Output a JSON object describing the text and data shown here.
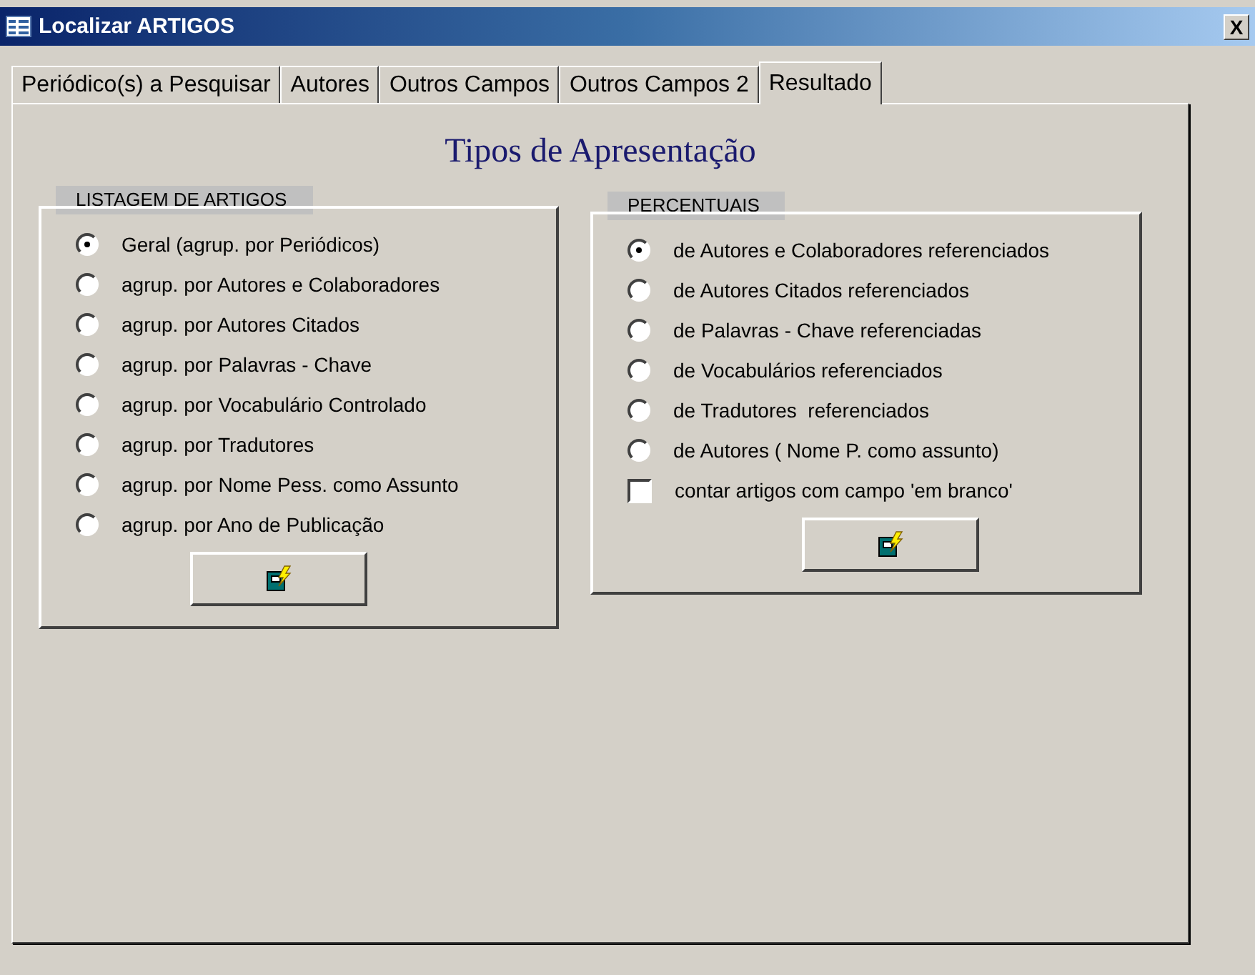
{
  "window": {
    "title": "Localizar ARTIGOS",
    "close": "X"
  },
  "tabs": [
    {
      "label": "Periódico(s) a Pesquisar",
      "selected": false
    },
    {
      "label": "Autores",
      "selected": false
    },
    {
      "label": "Outros Campos",
      "selected": false
    },
    {
      "label": "Outros Campos 2",
      "selected": false
    },
    {
      "label": "Resultado",
      "selected": true
    }
  ],
  "heading": "Tipos de Apresentação",
  "groups": [
    {
      "title": "LISTAGEM DE ARTIGOS",
      "options": [
        {
          "label": "Geral (agrup. por Periódicos)",
          "selected": true
        },
        {
          "label": "agrup. por Autores e Colaboradores",
          "selected": false
        },
        {
          "label": "agrup. por Autores Citados",
          "selected": false
        },
        {
          "label": "agrup. por Palavras - Chave",
          "selected": false
        },
        {
          "label": "agrup. por Vocabulário Controlado",
          "selected": false
        },
        {
          "label": "agrup. por Tradutores",
          "selected": false
        },
        {
          "label": "agrup. por Nome Pess. como Assunto",
          "selected": false
        },
        {
          "label": "agrup. por Ano de Publicação",
          "selected": false
        }
      ]
    },
    {
      "title": "PERCENTUAIS",
      "options": [
        {
          "label": "de Autores e Colaboradores referenciados",
          "selected": true
        },
        {
          "label": "de Autores Citados referenciados",
          "selected": false
        },
        {
          "label": "de Palavras - Chave referenciadas",
          "selected": false
        },
        {
          "label": "de Vocabulários referenciados",
          "selected": false
        },
        {
          "label": "de Tradutores  referenciados",
          "selected": false
        },
        {
          "label": "de Autores ( Nome P. como assunto)",
          "selected": false
        }
      ],
      "checkboxes": [
        {
          "label": "contar artigos com campo 'em branco'",
          "checked": false
        }
      ]
    }
  ]
}
